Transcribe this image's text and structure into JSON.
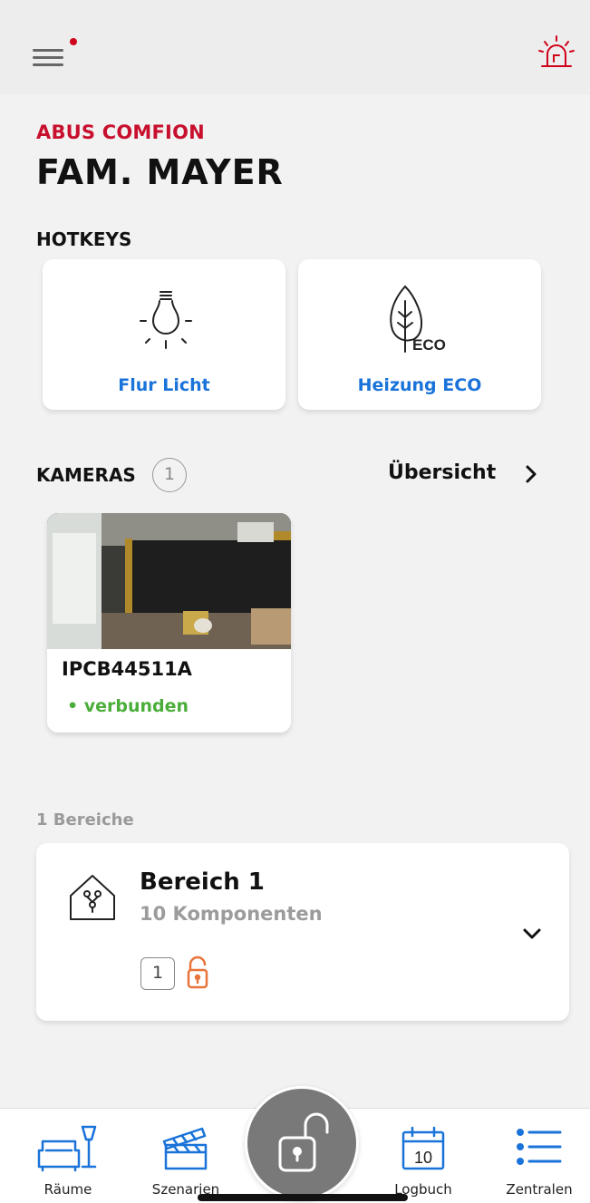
{
  "header": {
    "menu_icon": "hamburger-menu-icon",
    "alarm_icon": "alarm-siren-icon",
    "brand": "ABUS COMFION",
    "title": "FAM. MAYER"
  },
  "hotkeys": {
    "heading": "HOTKEYS",
    "items": [
      {
        "label": "Flur Licht",
        "icon": "light-bulb-icon"
      },
      {
        "label": "Heizung ECO",
        "icon": "eco-leaf-icon",
        "icon_text": "ECO"
      }
    ]
  },
  "cameras": {
    "heading": "KAMERAS",
    "count": "1",
    "overview_label": "Übersicht",
    "items": [
      {
        "name": "IPCB44511A",
        "status": "• verbunden",
        "status_color": "#4cae3a"
      }
    ]
  },
  "areas": {
    "count_label": "1 Bereiche",
    "items": [
      {
        "name": "Bereich 1",
        "subtitle": "10 Komponenten",
        "number": "1",
        "lock_state": "unlocked"
      }
    ]
  },
  "bottom_nav": {
    "items": [
      {
        "label": "Räume",
        "icon": "sofa-lamp-icon"
      },
      {
        "label": "Szenarien",
        "icon": "clapperboard-icon"
      },
      {
        "label": "Logbuch",
        "icon": "calendar-icon",
        "icon_text": "10"
      },
      {
        "label": "Zentralen",
        "icon": "list-icon"
      }
    ],
    "center_icon": "unlocked-padlock-icon"
  },
  "colors": {
    "brand_red": "#c8102e",
    "accent_blue": "#1a73d9",
    "status_green": "#4cae3a",
    "unlocked_orange": "#e8743b"
  }
}
